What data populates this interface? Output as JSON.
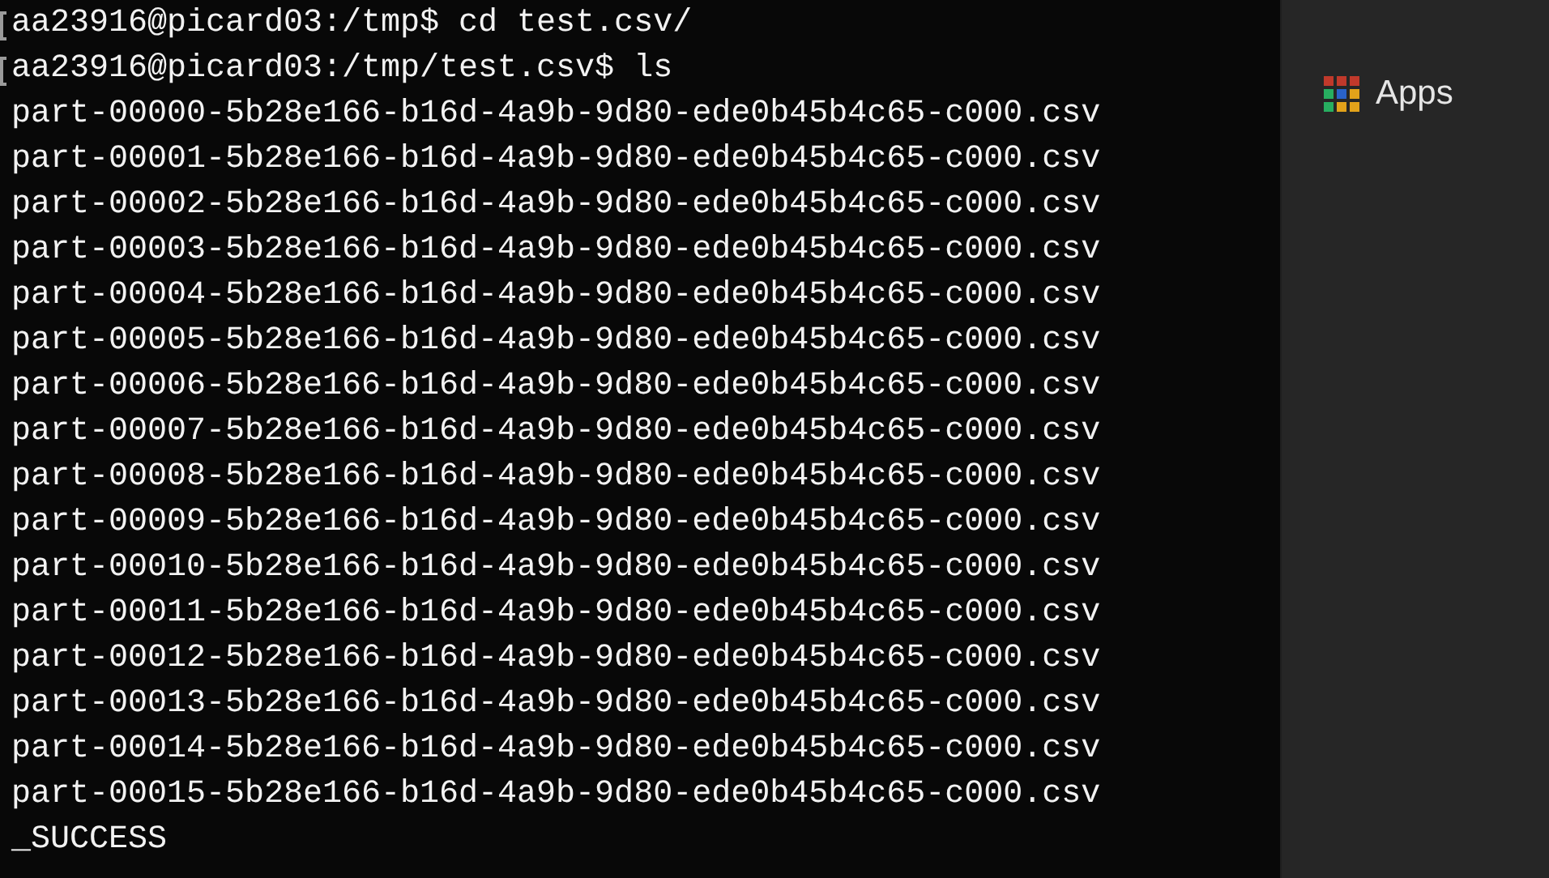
{
  "terminal": {
    "lines": [
      {
        "kind": "prompt",
        "text": "aa23916@picard03:/tmp$ cd test.csv/"
      },
      {
        "kind": "prompt",
        "text": "aa23916@picard03:/tmp/test.csv$ ls"
      },
      {
        "kind": "output",
        "text": "part-00000-5b28e166-b16d-4a9b-9d80-ede0b45b4c65-c000.csv"
      },
      {
        "kind": "output",
        "text": "part-00001-5b28e166-b16d-4a9b-9d80-ede0b45b4c65-c000.csv"
      },
      {
        "kind": "output",
        "text": "part-00002-5b28e166-b16d-4a9b-9d80-ede0b45b4c65-c000.csv"
      },
      {
        "kind": "output",
        "text": "part-00003-5b28e166-b16d-4a9b-9d80-ede0b45b4c65-c000.csv"
      },
      {
        "kind": "output",
        "text": "part-00004-5b28e166-b16d-4a9b-9d80-ede0b45b4c65-c000.csv"
      },
      {
        "kind": "output",
        "text": "part-00005-5b28e166-b16d-4a9b-9d80-ede0b45b4c65-c000.csv"
      },
      {
        "kind": "output",
        "text": "part-00006-5b28e166-b16d-4a9b-9d80-ede0b45b4c65-c000.csv"
      },
      {
        "kind": "output",
        "text": "part-00007-5b28e166-b16d-4a9b-9d80-ede0b45b4c65-c000.csv"
      },
      {
        "kind": "output",
        "text": "part-00008-5b28e166-b16d-4a9b-9d80-ede0b45b4c65-c000.csv"
      },
      {
        "kind": "output",
        "text": "part-00009-5b28e166-b16d-4a9b-9d80-ede0b45b4c65-c000.csv"
      },
      {
        "kind": "output",
        "text": "part-00010-5b28e166-b16d-4a9b-9d80-ede0b45b4c65-c000.csv"
      },
      {
        "kind": "output",
        "text": "part-00011-5b28e166-b16d-4a9b-9d80-ede0b45b4c65-c000.csv"
      },
      {
        "kind": "output",
        "text": "part-00012-5b28e166-b16d-4a9b-9d80-ede0b45b4c65-c000.csv"
      },
      {
        "kind": "output",
        "text": "part-00013-5b28e166-b16d-4a9b-9d80-ede0b45b4c65-c000.csv"
      },
      {
        "kind": "output",
        "text": "part-00014-5b28e166-b16d-4a9b-9d80-ede0b45b4c65-c000.csv"
      },
      {
        "kind": "output",
        "text": "part-00015-5b28e166-b16d-4a9b-9d80-ede0b45b4c65-c000.csv"
      },
      {
        "kind": "output",
        "text": "_SUCCESS"
      }
    ]
  },
  "browser": {
    "bookmarks": [
      {
        "label": "Apps"
      }
    ]
  }
}
